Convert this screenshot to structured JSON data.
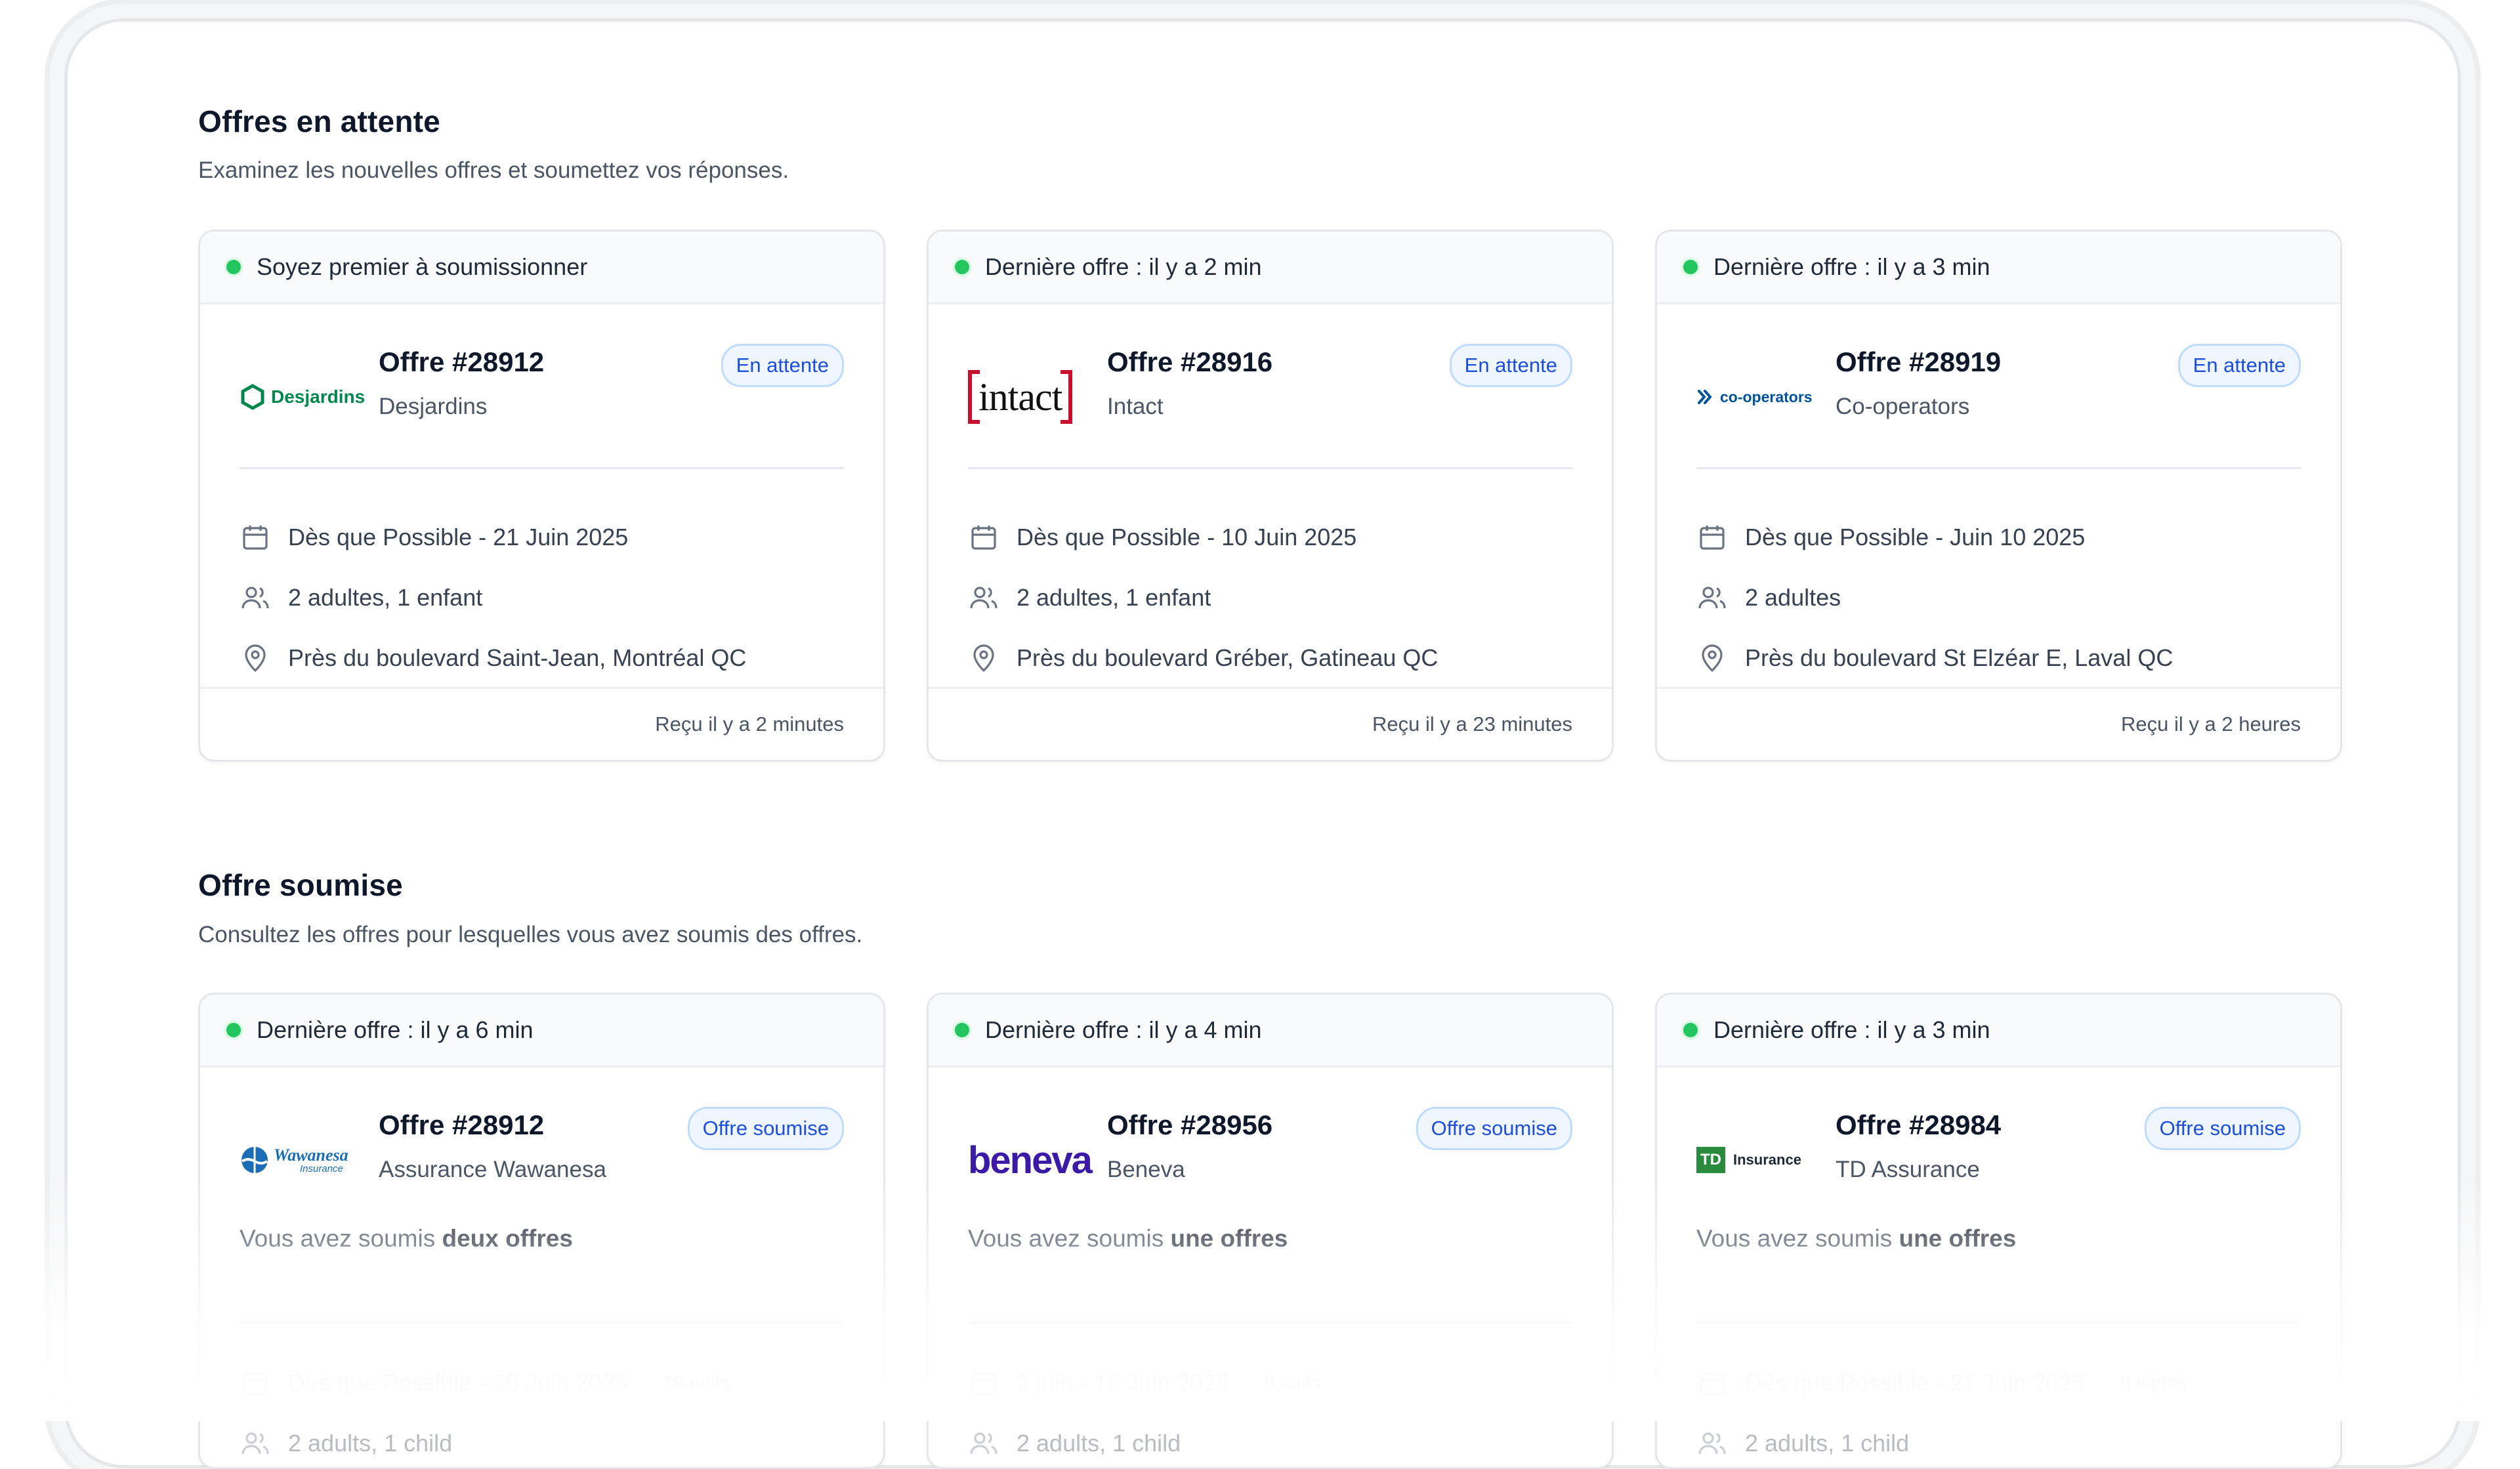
{
  "pending": {
    "title": "Offres en attente",
    "subtitle": "Examinez les nouvelles offres et soumettez vos réponses.",
    "cards": [
      {
        "header": "Soyez premier à soumissionner",
        "offer": "Offre #28912",
        "company": "Desjardins",
        "logo_text": "Desjardins",
        "badge": "En attente",
        "dates": "Dès que Possible - 21 Juin 2025",
        "guests": "2 adultes, 1 enfant",
        "location": "Près du boulevard Saint-Jean, Montréal QC",
        "received": "Reçu il y a 2 minutes"
      },
      {
        "header": "Dernière offre : il y a 2 min",
        "offer": "Offre #28916",
        "company": "Intact",
        "logo_text": "intact",
        "badge": "En attente",
        "dates": "Dès que Possible - 10 Juin 2025",
        "guests": "2 adultes, 1 enfant",
        "location": "Près du boulevard Gréber, Gatineau QC",
        "received": "Reçu il y a 23 minutes"
      },
      {
        "header": "Dernière offre : il y a 3 min",
        "offer": "Offre #28919",
        "company": "Co-operators",
        "logo_text": "co-operators",
        "badge": "En attente",
        "dates": "Dès que Possible - Juin 10 2025",
        "guests": "2 adultes",
        "location": "Près du boulevard St Elzéar E, Laval QC",
        "received": "Reçu il y a 2 heures"
      }
    ]
  },
  "submitted": {
    "title": "Offre soumise",
    "subtitle": "Consultez les offres pour lesquelles vous avez soumis des offres.",
    "cards": [
      {
        "header": "Dernière offre : il y a 6 min",
        "offer": "Offre #28912",
        "company": "Assurance Wawanesa",
        "logo_text": "Wawanesa",
        "logo_sub": "Insurance",
        "badge": "Offre soumise",
        "lead": "Vous avez soumis ",
        "count": "deux offres",
        "dates": "Dès que Possible - 30 Juin 2025",
        "nights": "10 nuits",
        "guests": "2 adults, 1 child"
      },
      {
        "header": "Dernière offre : il y a 4 min",
        "offer": "Offre #28956",
        "company": "Beneva",
        "logo_text": "beneva",
        "badge": "Offre soumise",
        "lead": "Vous avez soumis ",
        "count": "une offres",
        "dates": "2 juin - 10 Juin 2025",
        "nights": "8 nuits",
        "guests": "2 adults, 1 child"
      },
      {
        "header": "Dernière offre : il y a 3 min",
        "offer": "Offre #28984",
        "company": "TD Assurance",
        "logo_text": "Insurance",
        "logo_mark": "TD",
        "badge": "Offre soumise",
        "lead": "Vous avez soumis ",
        "count": "une offres",
        "dates": "Dès que Possible - 21 Juin 2025",
        "nights": "8 nights",
        "guests": "2 adults, 1 child"
      }
    ]
  },
  "colors": {
    "accent_green": "#22c55e",
    "badge_blue": "#1d4ed8",
    "desjardins_green": "#00874e",
    "intact_red": "#c8102e",
    "cooperators_blue": "#00539b",
    "wawanesa_blue": "#1b6db5",
    "beneva_purple": "#3b1aa6",
    "td_green": "#2a8a3e"
  }
}
